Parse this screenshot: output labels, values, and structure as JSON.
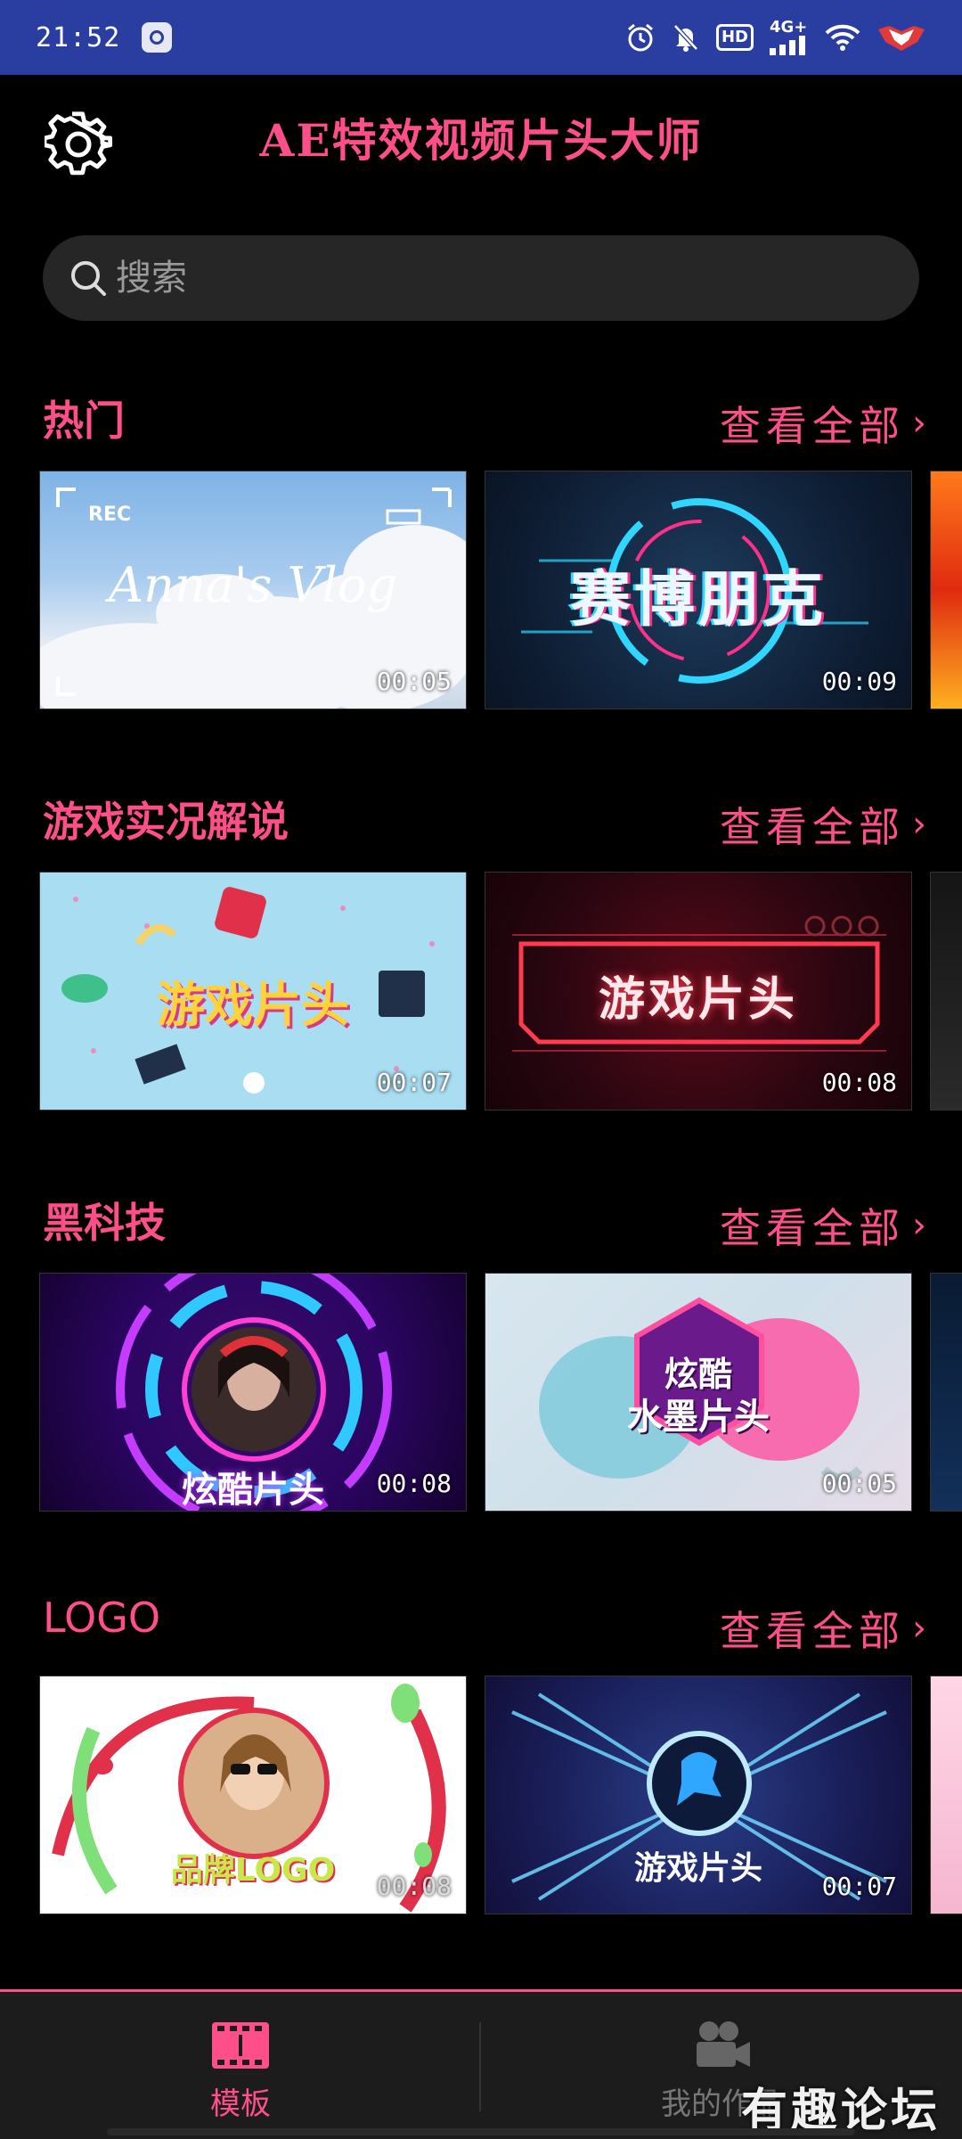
{
  "status_bar": {
    "time": "21:52",
    "hd_label": "HD",
    "network_label": "4G+"
  },
  "header": {
    "title": "AE特效视频片头大师",
    "settings_icon": "gear-icon"
  },
  "search": {
    "placeholder": "搜索",
    "icon": "search-icon"
  },
  "sections": [
    {
      "title": "热门",
      "see_all": "查看全部",
      "cards": [
        {
          "title": "Anna's Vlog",
          "badge": "REC",
          "duration": "00:05"
        },
        {
          "title": "赛博朋克",
          "duration": "00:09"
        }
      ]
    },
    {
      "title": "游戏实况解说",
      "see_all": "查看全部",
      "cards": [
        {
          "title": "游戏片头",
          "duration": "00:07"
        },
        {
          "title": "游戏片头",
          "duration": "00:08"
        }
      ]
    },
    {
      "title": "黑科技",
      "see_all": "查看全部",
      "cards": [
        {
          "title": "炫酷片头",
          "duration": "00:08"
        },
        {
          "title": "炫酷",
          "subtitle": "水墨片头",
          "duration": "00:05"
        }
      ]
    },
    {
      "title": "LOGO",
      "see_all": "查看全部",
      "cards": [
        {
          "title": "品牌LOGO",
          "duration": "00:08"
        },
        {
          "title": "游戏片头",
          "duration": "00:07"
        }
      ]
    }
  ],
  "bottom_nav": {
    "items": [
      {
        "label": "模板",
        "icon": "film-icon",
        "active": true
      },
      {
        "label": "我的作品",
        "icon": "video-camera-icon",
        "active": false
      }
    ]
  },
  "watermark": "有趣论坛",
  "colors": {
    "accent": "#ff4f8b",
    "status_bar": "#2a3da0",
    "background": "#000000",
    "search_bg": "#262626"
  }
}
